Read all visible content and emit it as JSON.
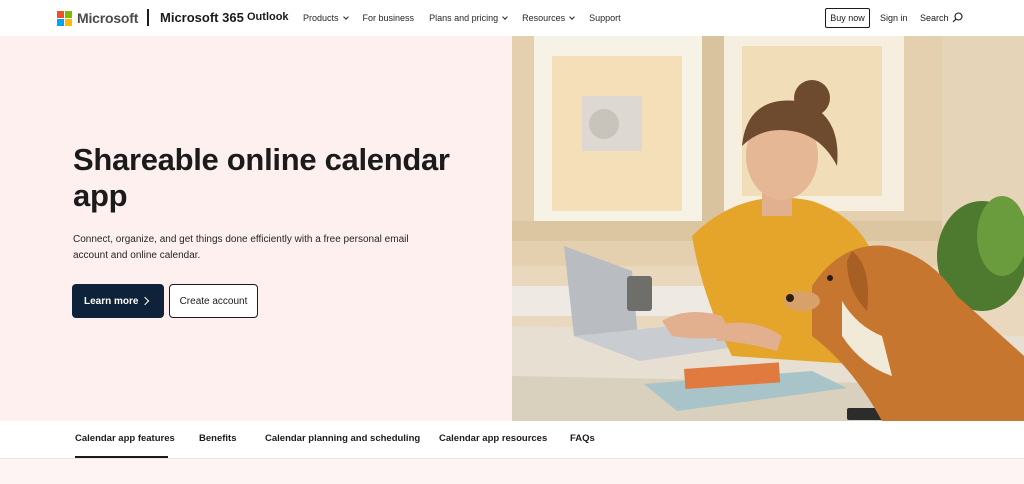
{
  "header": {
    "logo_text": "Microsoft",
    "brand": "Microsoft 365",
    "product": "Outlook",
    "nav": [
      {
        "label": "Products",
        "has_dropdown": true
      },
      {
        "label": "For business",
        "has_dropdown": false
      },
      {
        "label": "Plans and pricing",
        "has_dropdown": true
      },
      {
        "label": "Resources",
        "has_dropdown": true
      },
      {
        "label": "Support",
        "has_dropdown": false
      }
    ],
    "buy_now": "Buy now",
    "sign_in": "Sign in",
    "search": "Search"
  },
  "hero": {
    "title": "Shareable online calendar app",
    "description": "Connect, organize, and get things done efficiently with a free personal email account and online calendar.",
    "primary_button": "Learn more",
    "secondary_button": "Create account",
    "image_icon": "photo-woman-laptop-dog"
  },
  "tabs": {
    "items": [
      {
        "label": "Calendar app features",
        "active": true
      },
      {
        "label": "Benefits",
        "active": false
      },
      {
        "label": "Calendar planning and scheduling",
        "active": false
      },
      {
        "label": "Calendar app resources",
        "active": false
      },
      {
        "label": "FAQs",
        "active": false
      }
    ]
  },
  "colors": {
    "hero_bg": "#fdf0ee",
    "primary_button": "#0e2239",
    "ms_red": "#f25022",
    "ms_green": "#7fba00",
    "ms_blue": "#00a4ef",
    "ms_yellow": "#ffb900"
  }
}
